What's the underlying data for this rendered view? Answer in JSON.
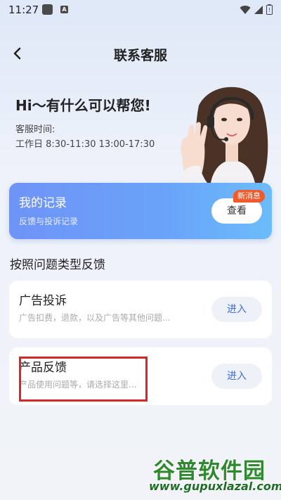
{
  "status_bar": {
    "time": "11:27",
    "icons": [
      "app-notification-icon",
      "a-notification-icon",
      "wifi-icon",
      "signal-icon",
      "battery-icon"
    ]
  },
  "nav": {
    "title": "联系客服",
    "back_icon": "chevron-left-icon"
  },
  "hero": {
    "greeting": "Hi～有什么可以帮您!",
    "service_time_label": "客服时间:",
    "service_time_value": "工作日 8:30-11:30 13:00-17:30"
  },
  "records": {
    "title": "我的记录",
    "subtitle": "反馈与投诉记录",
    "view_label": "查看",
    "badge": "新消息"
  },
  "section_title": "按照问题类型反馈",
  "feedback_items": [
    {
      "title": "广告投诉",
      "description": "广告扣费，退款，以及广告等其他问题...",
      "enter_label": "进入"
    },
    {
      "title": "产品反馈",
      "description": "产品使用问题等，请选择这里...",
      "enter_label": "进入"
    }
  ],
  "watermark": {
    "line1": "谷普软件园",
    "line2": "www.gupuxlazal.com"
  },
  "colors": {
    "accent_blue": "#3b6fe0",
    "records_gradient_start": "#6f93f7",
    "records_gradient_end": "#6bbcfb",
    "badge_red": "#f15a2b",
    "highlight_red": "#d9262a",
    "watermark_green": "#2f8a2f"
  }
}
